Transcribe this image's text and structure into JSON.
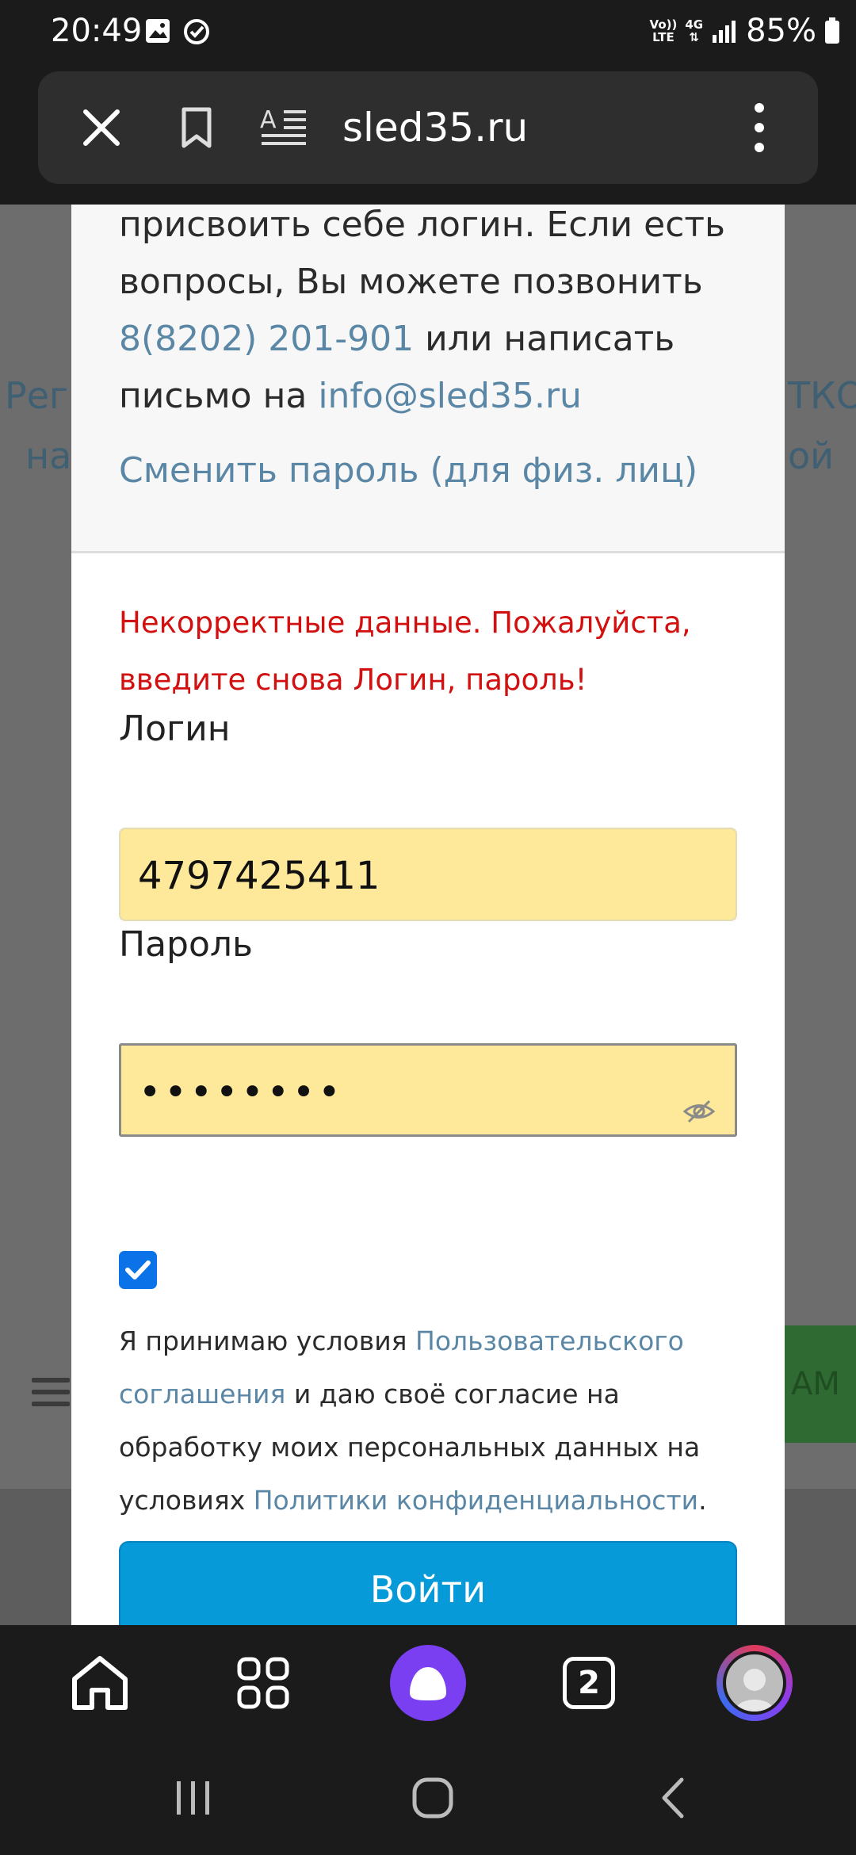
{
  "status_bar": {
    "time": "20:49",
    "network_top": "Vo))",
    "network_bottom": "LTE",
    "net_4g": "4G",
    "battery": "85%"
  },
  "browser": {
    "url": "sled35.ru",
    "tabs_count": "2"
  },
  "background_page": {
    "fragment_left_1": "Реги",
    "fragment_left_2": "на",
    "fragment_right_1": "ТКО",
    "fragment_right_2": "ой",
    "button_fragment": "АМ"
  },
  "modal": {
    "info": {
      "line1": "присвоить себе логин. Если есть",
      "line2": "вопросы, Вы можете позвонить",
      "phone": "8(8202) 201-901",
      "after_phone": " или написать",
      "before_email": "письмо на ",
      "email": "info@sled35.ru"
    },
    "change_password_link": "Сменить пароль (для физ. лиц)",
    "error": "Некорректные данные. Пожалуйста, введите снова Логин, пароль!",
    "login_label": "Логин",
    "login_value": "4797425411",
    "password_label": "Пароль",
    "password_value": "••••••••",
    "agreement": {
      "text1": "Я принимаю условия ",
      "link1": "Пользовательского соглашения",
      "text2": " и даю своё согласие на обработку моих персональных данных на условиях ",
      "link2": "Политики конфиденциальности",
      "text3": "."
    },
    "submit_label": "Войти"
  }
}
